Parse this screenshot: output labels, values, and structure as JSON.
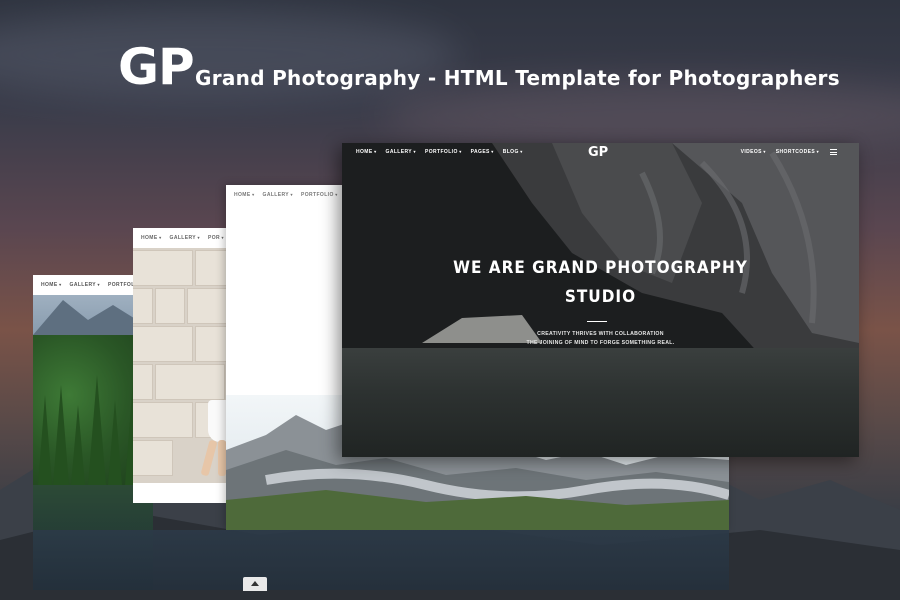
{
  "brand": {
    "logo": "GP",
    "tagline": "Grand Photography - HTML Template for Photographers"
  },
  "card_forest": {
    "nav": [
      "HOME",
      "GALLERY",
      "PORTFOLIO"
    ]
  },
  "card_brick": {
    "nav": [
      "HOME",
      "GALLERY",
      "POR"
    ]
  },
  "card_white": {
    "nav": [
      "HOME",
      "GALLERY",
      "PORTFOLIO"
    ]
  },
  "card_hero": {
    "nav_left": [
      "HOME",
      "GALLERY",
      "PORTFOLIO",
      "PAGES",
      "BLOG"
    ],
    "logo": "GP",
    "nav_right": [
      "VIDEOS",
      "SHORTCODES"
    ],
    "title_line1": "WE ARE GRAND PHOTOGRAPHY",
    "title_line2": "STUDIO",
    "sub_line1": "CREATIVITY THRIVES WITH COLLABORATION",
    "sub_line2": "THE JOINING OF MIND TO FORGE SOMETHING REAL."
  },
  "icons": {
    "menu": "hamburger-icon",
    "scroll_top": "chevron-up-icon"
  }
}
